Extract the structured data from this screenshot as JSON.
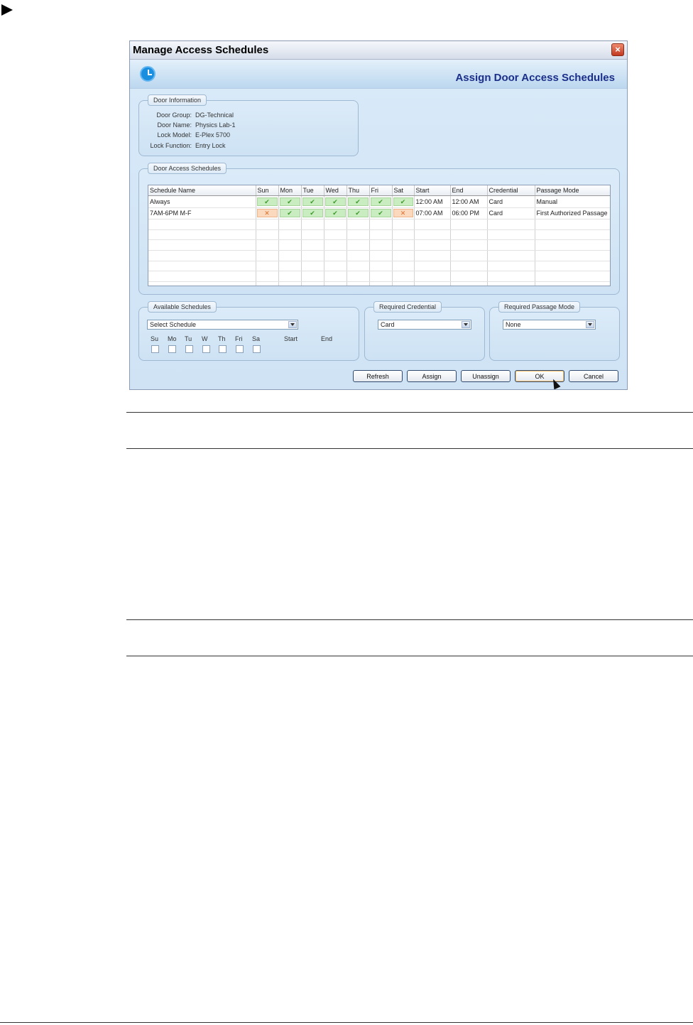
{
  "window": {
    "title": "Manage Access Schedules",
    "header_title": "Assign Door Access Schedules"
  },
  "door_info": {
    "legend": "Door Information",
    "rows": [
      {
        "label": "Door Group:",
        "value": "DG-Technical"
      },
      {
        "label": "Door Name:",
        "value": "Physics Lab-1"
      },
      {
        "label": "Lock Model:",
        "value": "E-Plex 5700"
      },
      {
        "label": "Lock Function:",
        "value": "Entry Lock"
      }
    ]
  },
  "schedules": {
    "legend": "Door Access Schedules",
    "columns": [
      "Schedule Name",
      "Sun",
      "Mon",
      "Tue",
      "Wed",
      "Thu",
      "Fri",
      "Sat",
      "Start",
      "End",
      "Credential",
      "Passage Mode"
    ],
    "rows": [
      {
        "name": "Always",
        "days": [
          true,
          true,
          true,
          true,
          true,
          true,
          true
        ],
        "start": "12:00 AM",
        "end": "12:00 AM",
        "credential": "Card",
        "passage": "Manual"
      },
      {
        "name": "7AM-6PM M-F",
        "days": [
          false,
          true,
          true,
          true,
          true,
          true,
          false
        ],
        "start": "07:00 AM",
        "end": "06:00 PM",
        "credential": "Card",
        "passage": "First Authorized Passage"
      }
    ]
  },
  "available": {
    "legend": "Available Schedules",
    "select_value": "Select Schedule",
    "day_labels": [
      "Su",
      "Mo",
      "Tu",
      "W",
      "Th",
      "Fri",
      "Sa"
    ],
    "start_label": "Start",
    "end_label": "End"
  },
  "credential": {
    "legend": "Required Credential",
    "value": "Card"
  },
  "passage": {
    "legend": "Required Passage Mode",
    "value": "None"
  },
  "buttons": {
    "refresh": "Refresh",
    "assign": "Assign",
    "unassign": "Unassign",
    "ok": "OK",
    "cancel": "Cancel"
  },
  "icons": {
    "close": "×",
    "check": "✔",
    "cross": "✕"
  }
}
